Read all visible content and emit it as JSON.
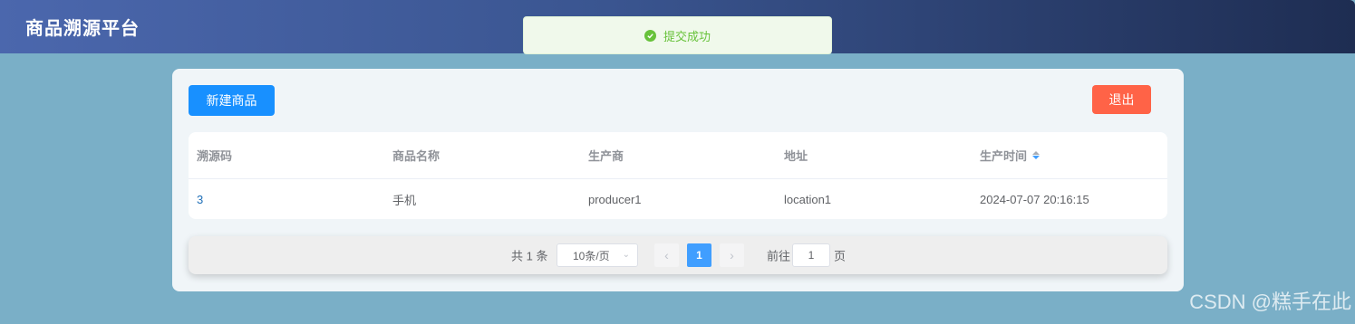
{
  "app": {
    "title": "商品溯源平台"
  },
  "toast": {
    "message": "提交成功",
    "color": "#67c23a"
  },
  "toolbar": {
    "new_label": "新建商品",
    "exit_label": "退出"
  },
  "table": {
    "headers": [
      "溯源码",
      "商品名称",
      "生产商",
      "地址",
      "生产时间"
    ],
    "rows": [
      {
        "code": "3",
        "name": "手机",
        "producer": "producer1",
        "location": "location1",
        "time": "2024-07-07 20:16:15"
      }
    ]
  },
  "pagination": {
    "total_text": "共 1 条",
    "page_size": "10条/页",
    "current_page": "1",
    "goto_label": "前往",
    "goto_value": "1",
    "goto_suffix": "页"
  },
  "watermark": "CSDN @糕手在此",
  "colors": {
    "accent": "#409eff",
    "new_button": "#1890ff",
    "exit_button": "#ff6347",
    "background": "#7aafc7"
  }
}
